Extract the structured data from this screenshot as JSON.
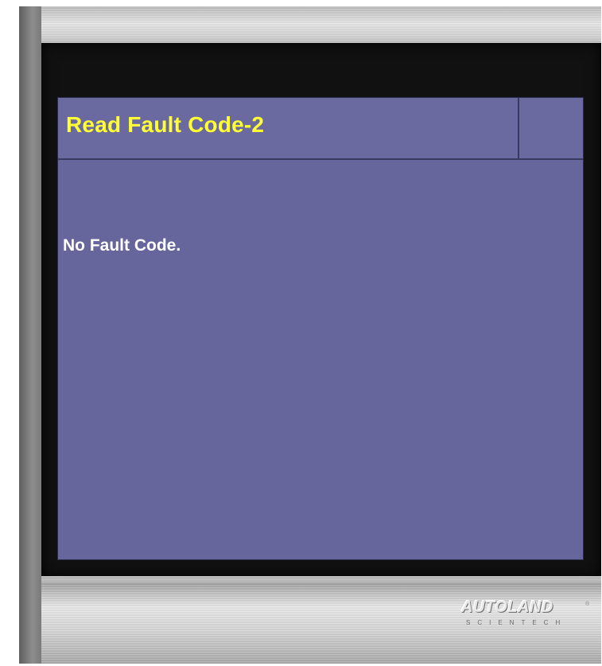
{
  "screen": {
    "title": "Read Fault Code-2",
    "message": "No Fault Code."
  },
  "brand": {
    "name": "AUTOLAND",
    "tagline": "SCIENTECH",
    "registered_mark": "®"
  },
  "colors": {
    "screen_background": "#66669c",
    "title_text": "#ffff33",
    "message_text": "#ffffff",
    "bezel": "#111111"
  }
}
